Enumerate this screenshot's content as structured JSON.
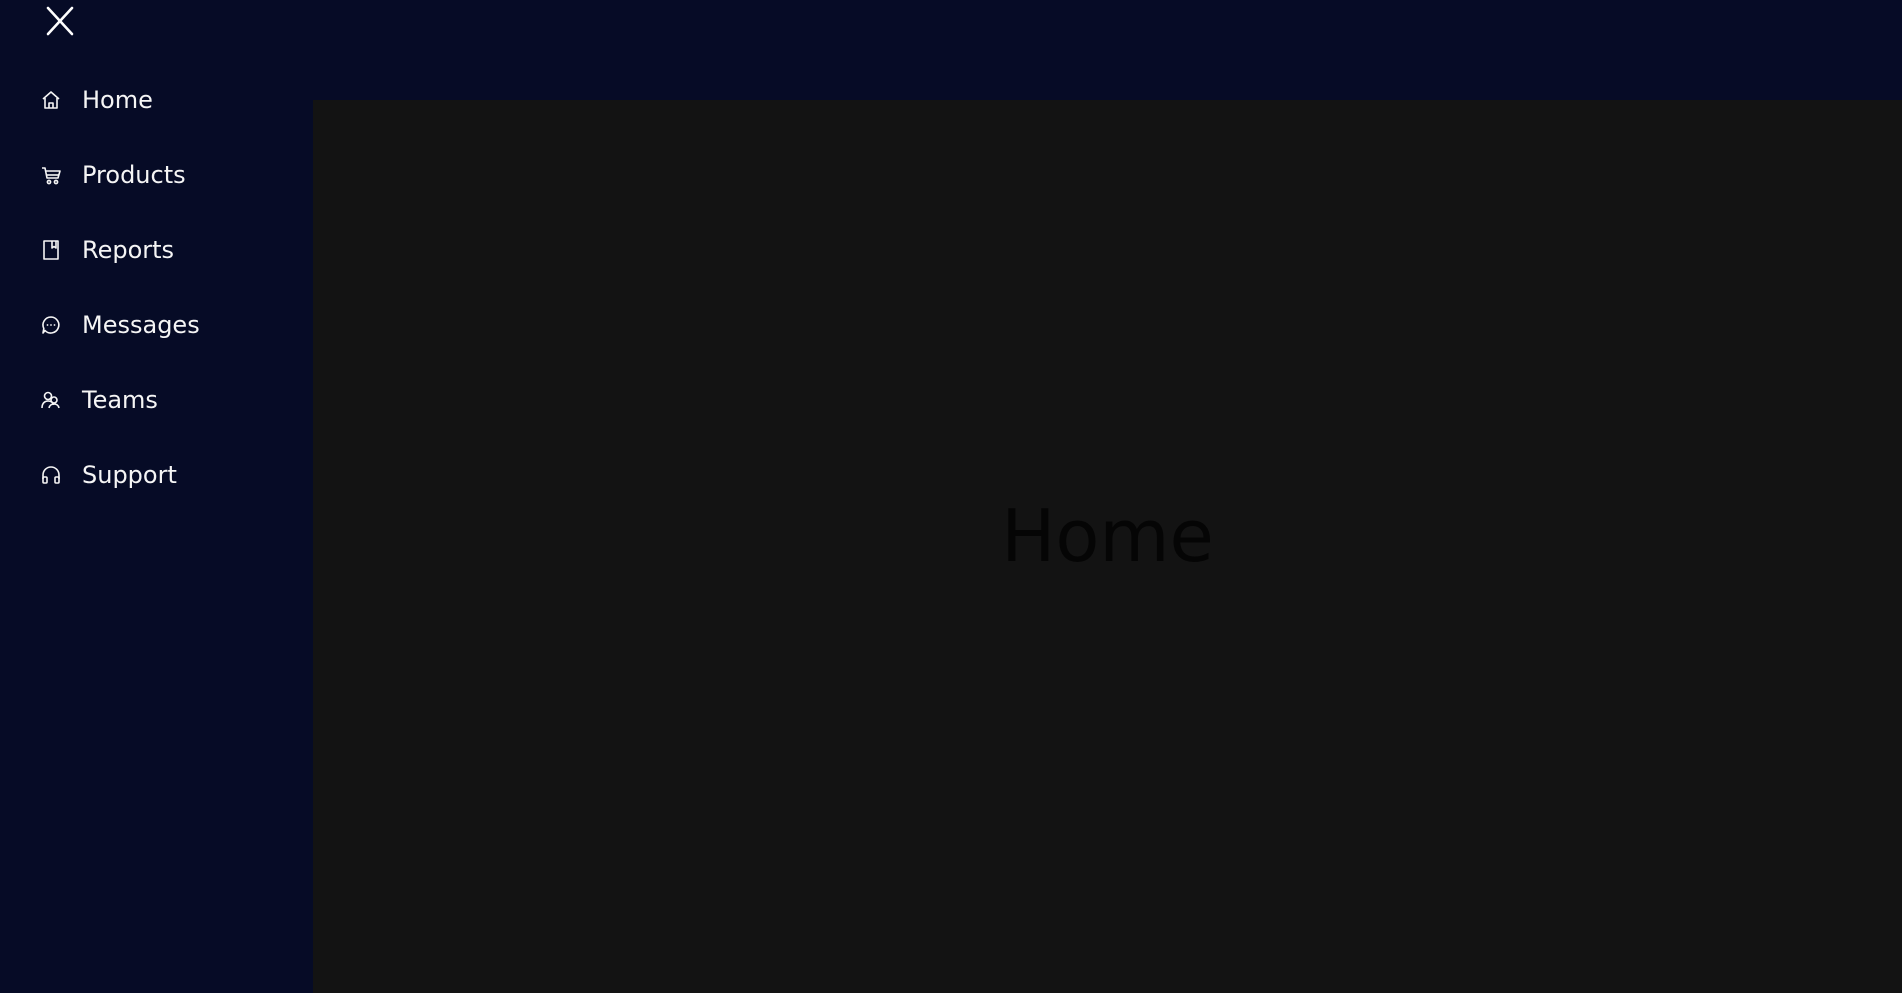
{
  "sidebar": {
    "close_icon": "close-icon",
    "items": [
      {
        "label": "Home",
        "icon": "home-icon"
      },
      {
        "label": "Products",
        "icon": "cart-icon"
      },
      {
        "label": "Reports",
        "icon": "report-icon"
      },
      {
        "label": "Messages",
        "icon": "message-icon"
      },
      {
        "label": "Teams",
        "icon": "team-icon"
      },
      {
        "label": "Support",
        "icon": "headset-icon"
      }
    ]
  },
  "main": {
    "title": "Home"
  },
  "colors": {
    "sidebar_bg": "#060b26",
    "main_bg": "#131313",
    "nav_text": "#f5f5f5",
    "title_text": "#050505"
  }
}
